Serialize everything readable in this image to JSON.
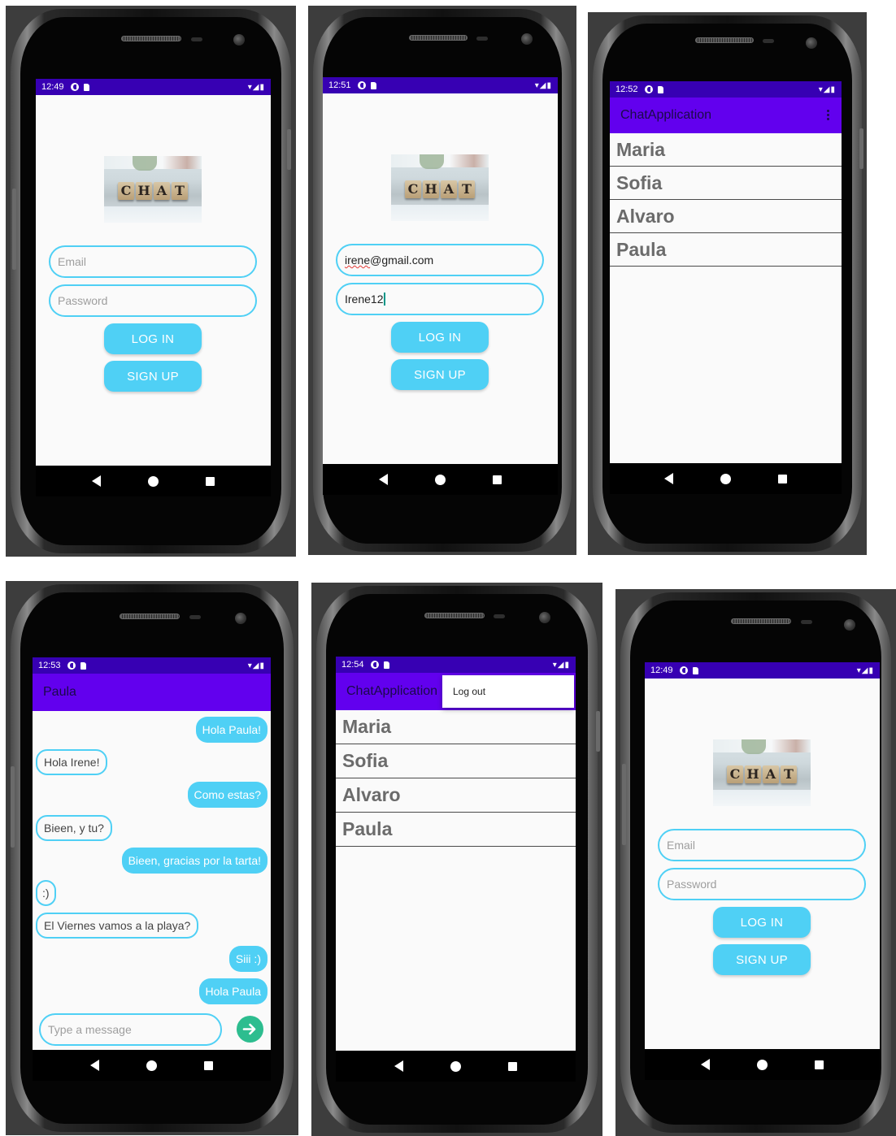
{
  "status": {
    "p1_time": "12:49",
    "p2_time": "12:51",
    "p3_time": "12:52",
    "p4_time": "12:53",
    "p5_time": "12:54",
    "p6_time": "12:49"
  },
  "logo_letters": [
    "C",
    "H",
    "A",
    "T"
  ],
  "login": {
    "email_placeholder": "Email",
    "password_placeholder": "Password",
    "login_label": "LOG IN",
    "signup_label": "SIGN UP"
  },
  "filled": {
    "email_underlined": "irene",
    "email_rest": "@gmail.com",
    "password": "Irene12"
  },
  "contacts": {
    "app_title": "ChatApplication",
    "names": [
      "Maria",
      "Sofia",
      "Alvaro",
      "Paula"
    ]
  },
  "menu": {
    "logout": "Log out"
  },
  "chat": {
    "title": "Paula",
    "messages": [
      {
        "dir": "out",
        "text": "Hola Paula!"
      },
      {
        "dir": "in",
        "text": "Hola Irene!"
      },
      {
        "dir": "out",
        "text": "Como estas?"
      },
      {
        "dir": "in",
        "text": "Bieen, y tu?"
      },
      {
        "dir": "out",
        "text": "Bieen, gracias por la tarta!"
      },
      {
        "dir": "in",
        "text": ":)"
      },
      {
        "dir": "in",
        "text": "El Viernes vamos a la playa?"
      },
      {
        "dir": "out",
        "text": "Siii :)"
      },
      {
        "dir": "out",
        "text": "Hola Paula"
      }
    ],
    "input_placeholder": "Type a message"
  },
  "colors": {
    "status_bar": "#3700b3",
    "app_bar": "#6200ee",
    "accent": "#4fd0f5",
    "send": "#2dbd8f"
  },
  "icons": [
    "back-icon",
    "home-icon",
    "recents-icon",
    "send-arrow-icon",
    "overflow-menu-icon",
    "wifi-icon",
    "signal-icon",
    "battery-icon"
  ]
}
